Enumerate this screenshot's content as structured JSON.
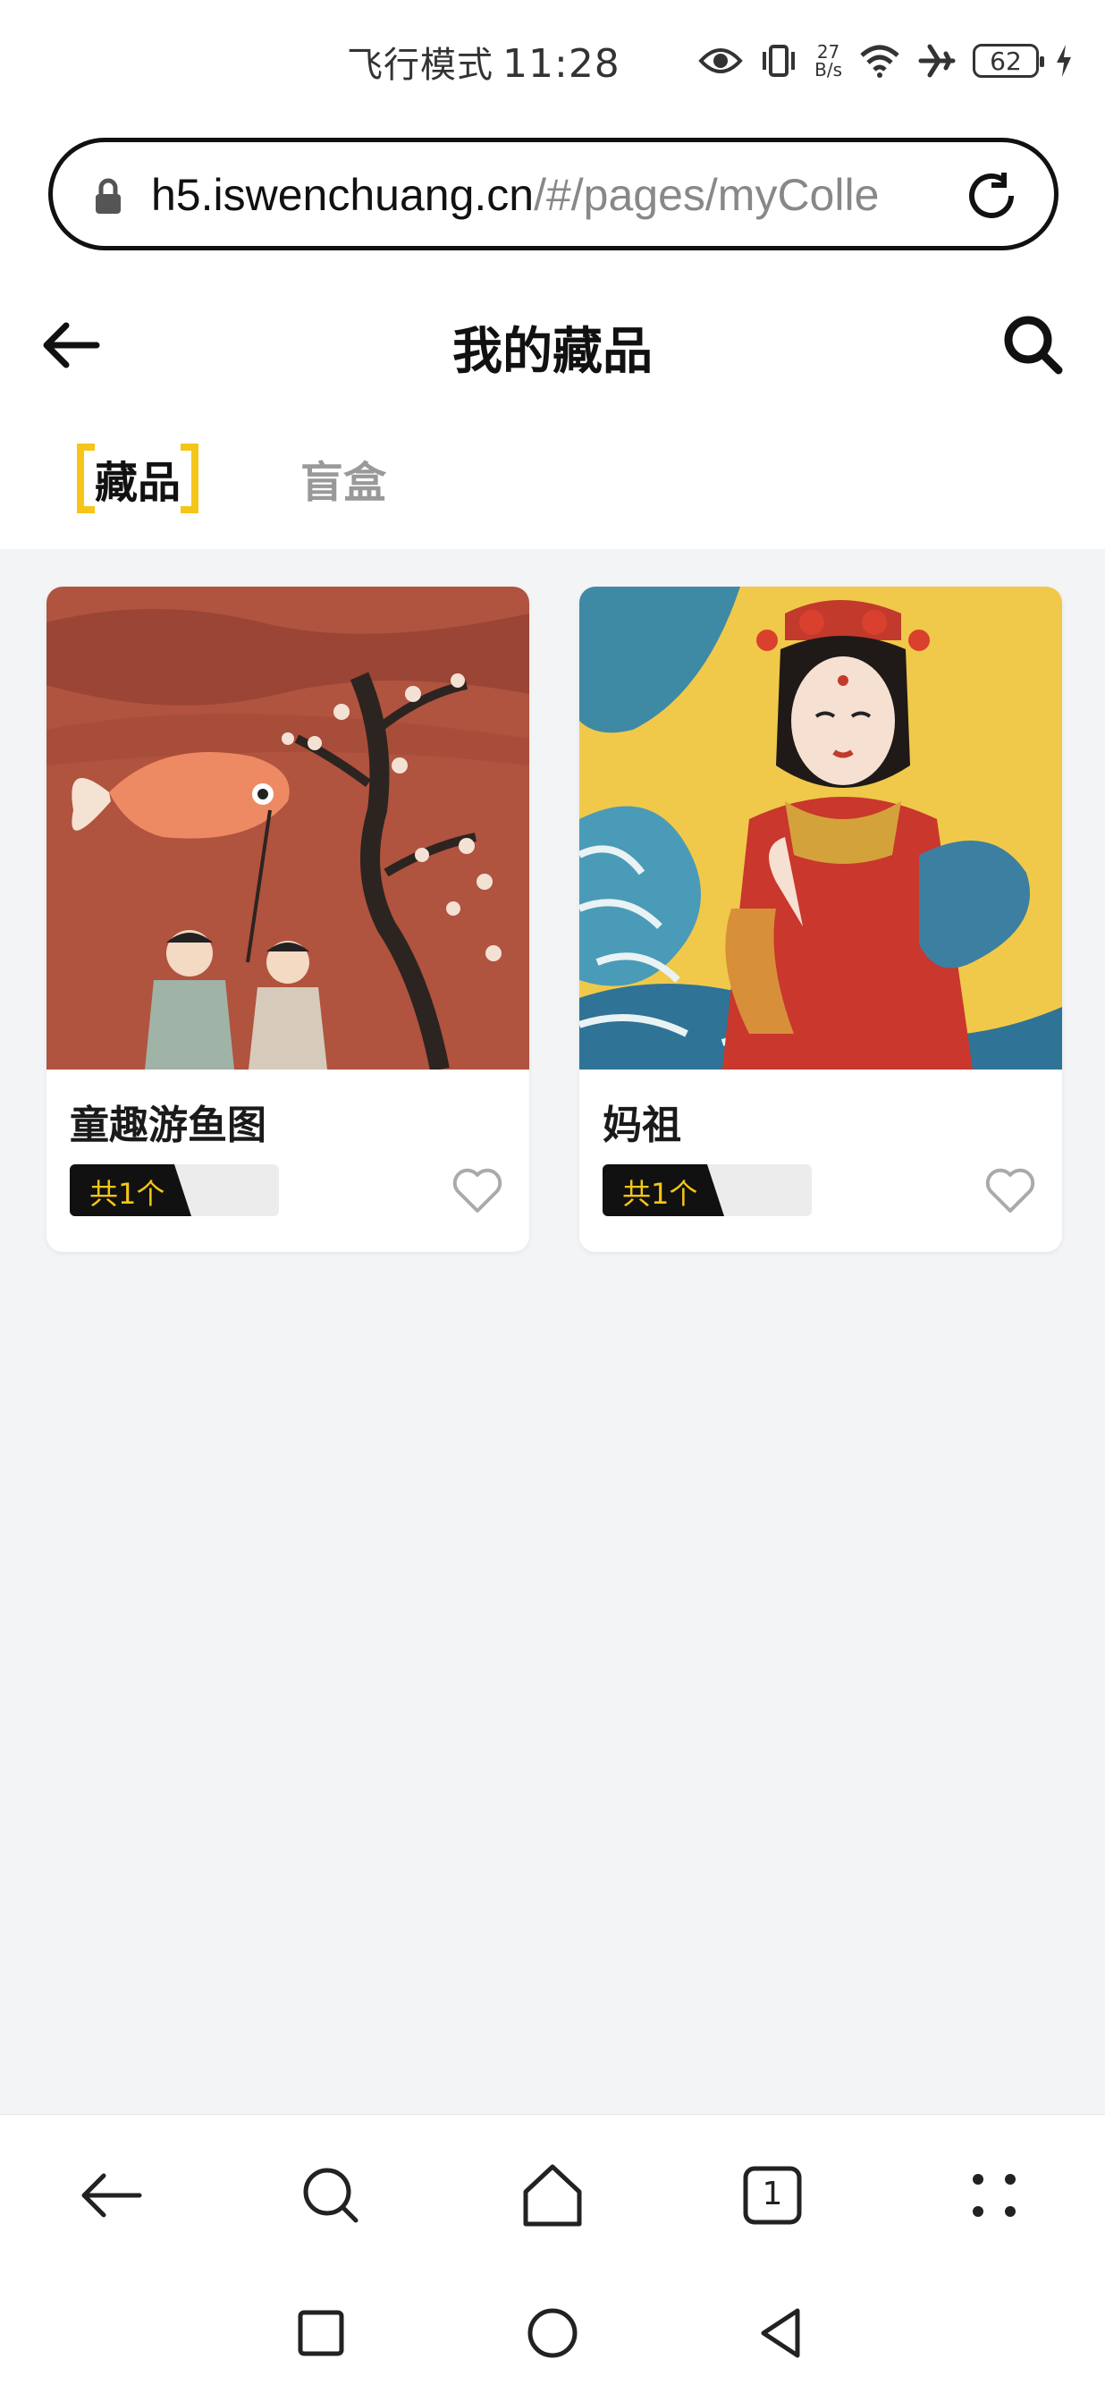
{
  "status_bar": {
    "mode": "飞行模式",
    "time": "11:28",
    "net_speed_value": "27",
    "net_speed_unit": "B/s",
    "battery": "62"
  },
  "browser": {
    "url_host": "h5.iswenchuang.cn",
    "url_path": "/#/pages/myColle"
  },
  "header": {
    "title": "我的藏品"
  },
  "tabs": [
    {
      "label": "藏品",
      "active": true
    },
    {
      "label": "盲盒",
      "active": false
    }
  ],
  "collection": [
    {
      "title": "童趣游鱼图",
      "count": "共1个"
    },
    {
      "title": "妈祖",
      "count": "共1个"
    }
  ],
  "bottom_nav": {
    "tab_count": "1"
  },
  "colors": {
    "accent": "#f5c518",
    "background": "#f3f4f6"
  },
  "icons": [
    "eye-icon",
    "vibrate-icon",
    "wifi-icon",
    "airplane-icon",
    "battery-icon",
    "charging-icon",
    "lock-icon",
    "reload-icon",
    "back-arrow-icon",
    "search-icon",
    "heart-icon",
    "home-icon",
    "tabs-icon",
    "menu-dots-icon",
    "recent-apps-icon",
    "home-circle-icon",
    "back-triangle-icon"
  ]
}
